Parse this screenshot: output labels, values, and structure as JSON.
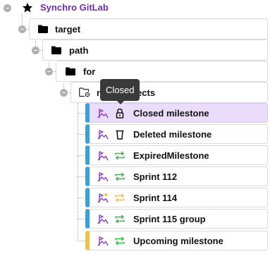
{
  "tree": {
    "root": {
      "label": "Synchro GitLab",
      "icon": "star-icon",
      "color": "#6b2fa0"
    },
    "folders": [
      {
        "label": "target",
        "icon": "folder-icon"
      },
      {
        "label": "path",
        "icon": "folder-icon"
      },
      {
        "label": "for",
        "icon": "folder-icon"
      },
      {
        "label": "new_projects",
        "icon": "folder-settings-icon"
      }
    ],
    "milestones": [
      {
        "label": "Closed milestone",
        "icon": "milestone-icon",
        "state_icon": "lock-icon",
        "selected": true,
        "accent": "#3aa0d8"
      },
      {
        "label": "Deleted milestone",
        "icon": "milestone-icon",
        "state_icon": "trash-icon",
        "selected": false,
        "accent": "#3aa0d8"
      },
      {
        "label": "ExpiredMilestone",
        "icon": "milestone-icon",
        "state_icon": "sync-icon",
        "selected": false,
        "accent": "#3aa0d8"
      },
      {
        "label": "Sprint 112",
        "icon": "milestone-icon",
        "state_icon": "sync-icon",
        "selected": false,
        "accent": "#3aa0d8"
      },
      {
        "label": "Sprint 114",
        "icon": "milestone-warning-icon",
        "state_icon": "sync-warning-icon",
        "selected": false,
        "accent": "#3aa0d8"
      },
      {
        "label": "Sprint 115 group",
        "icon": "milestone-icon",
        "state_icon": "sync-icon",
        "selected": false,
        "accent": "#3aa0d8"
      },
      {
        "label": "Upcoming milestone",
        "icon": "milestone-icon",
        "state_icon": "sync-icon",
        "selected": false,
        "accent": "#f0c24a"
      }
    ]
  },
  "tooltip": {
    "text": "Closed"
  },
  "colors": {
    "selected_bg": "#eadcfb",
    "sync_green": "#3bb54a",
    "sync_warning": "#f2c43d",
    "milestone_purple": "#8a3fc4"
  }
}
